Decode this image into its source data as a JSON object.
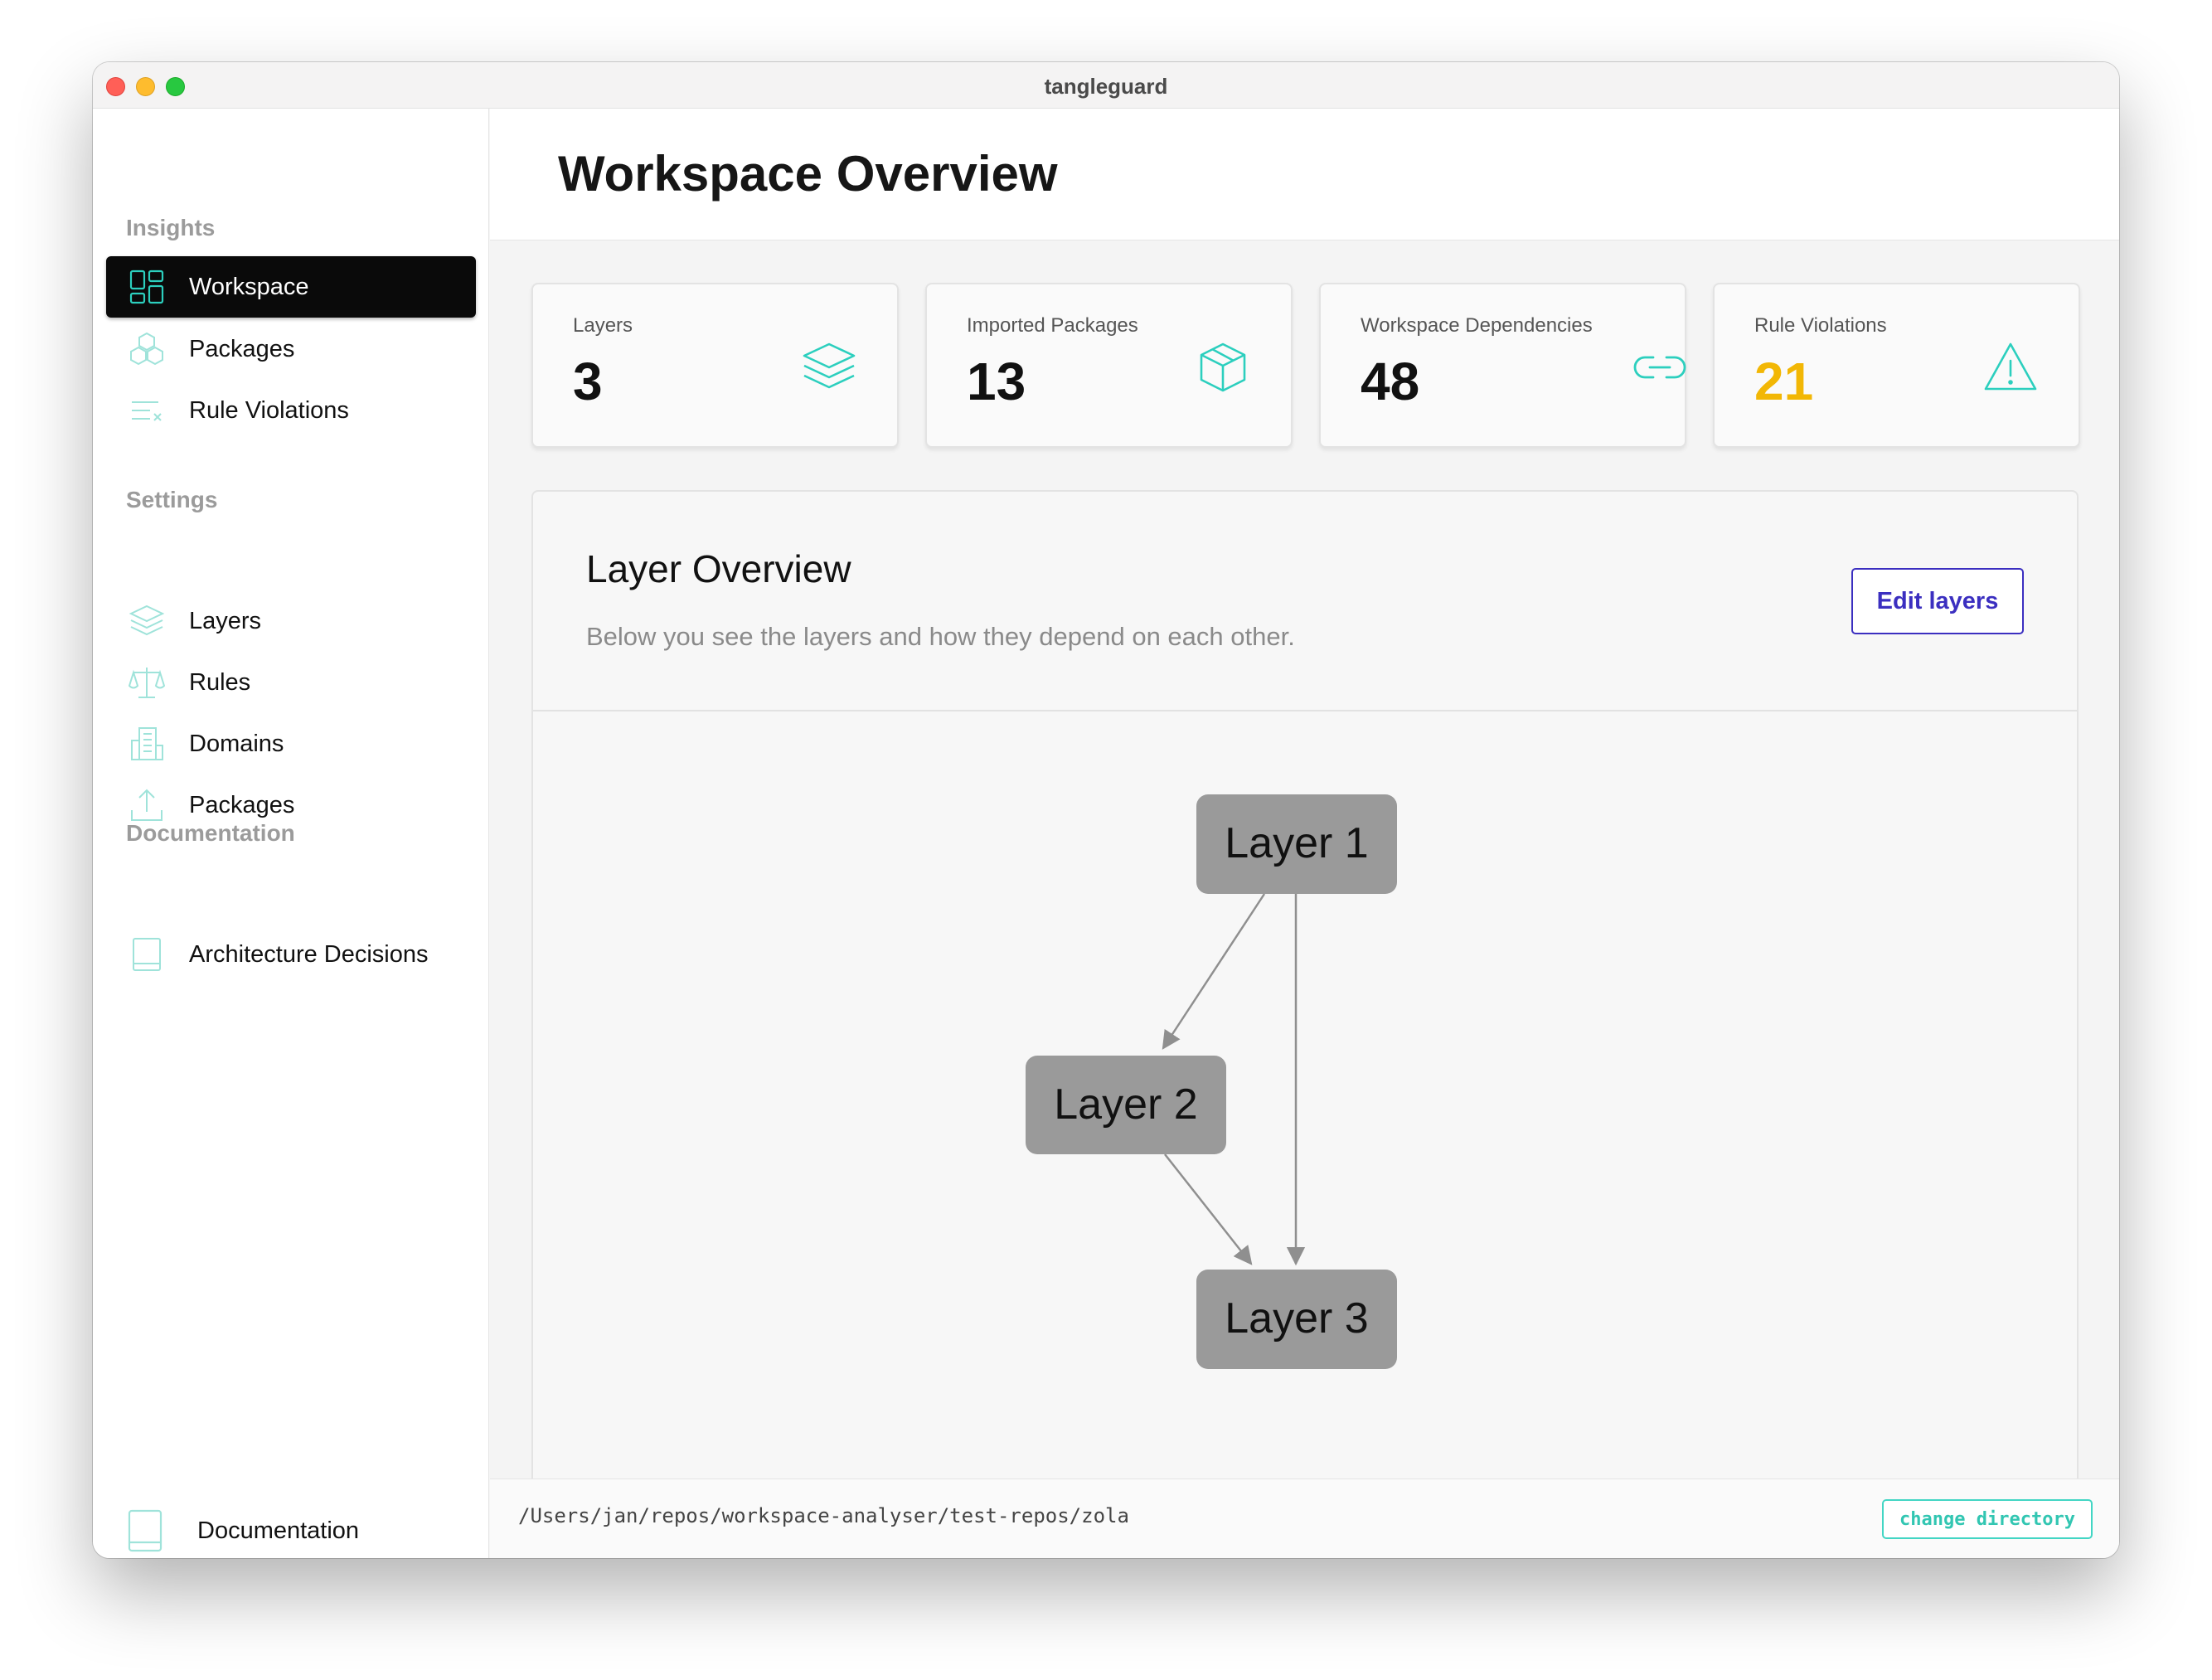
{
  "window": {
    "title": "tangleguard"
  },
  "sidebar": {
    "sections": [
      {
        "title": "Insights"
      },
      {
        "title": "Settings"
      },
      {
        "title": "Documentation"
      }
    ],
    "insights_items": [
      {
        "label": "Workspace",
        "icon": "workspace-grid-icon",
        "active": true
      },
      {
        "label": "Packages",
        "icon": "cubes-icon"
      },
      {
        "label": "Rule Violations",
        "icon": "list-x-icon"
      }
    ],
    "settings_items": [
      {
        "label": "Layers",
        "icon": "layers-icon"
      },
      {
        "label": "Rules",
        "icon": "scale-icon"
      },
      {
        "label": "Domains",
        "icon": "building-icon"
      },
      {
        "label": "Packages",
        "icon": "upload-icon"
      }
    ],
    "documentation_items": [
      {
        "label": "Architecture Decisions",
        "icon": "book-icon"
      }
    ],
    "footer_link": {
      "label": "Documentation",
      "icon": "book-icon"
    }
  },
  "header": {
    "title": "Workspace Overview"
  },
  "stats": [
    {
      "label": "Layers",
      "value": "3",
      "icon": "layers-icon"
    },
    {
      "label": "Imported Packages",
      "value": "13",
      "icon": "box-icon"
    },
    {
      "label": "Workspace Dependencies",
      "value": "48",
      "icon": "link-icon"
    },
    {
      "label": "Rule Violations",
      "value": "21",
      "icon": "warning-icon"
    }
  ],
  "layer_overview": {
    "title": "Layer Overview",
    "description": "Below you see the layers and how they depend on each other.",
    "edit_button": "Edit layers",
    "graph": {
      "nodes": [
        {
          "id": "l1",
          "label": "Layer 1"
        },
        {
          "id": "l2",
          "label": "Layer 2"
        },
        {
          "id": "l3",
          "label": "Layer 3"
        }
      ],
      "edges": [
        {
          "from": "l1",
          "to": "l2"
        },
        {
          "from": "l1",
          "to": "l3"
        },
        {
          "from": "l2",
          "to": "l3"
        }
      ]
    }
  },
  "footer": {
    "path": "/Users/jan/repos/workspace-analyser/test-repos/zola",
    "change_button": "change directory"
  },
  "colors": {
    "accent_teal": "#2ccfbe",
    "warning_yellow": "#f2b705",
    "button_purple": "#3b2fc0",
    "node_gray": "#9a9a9a"
  }
}
